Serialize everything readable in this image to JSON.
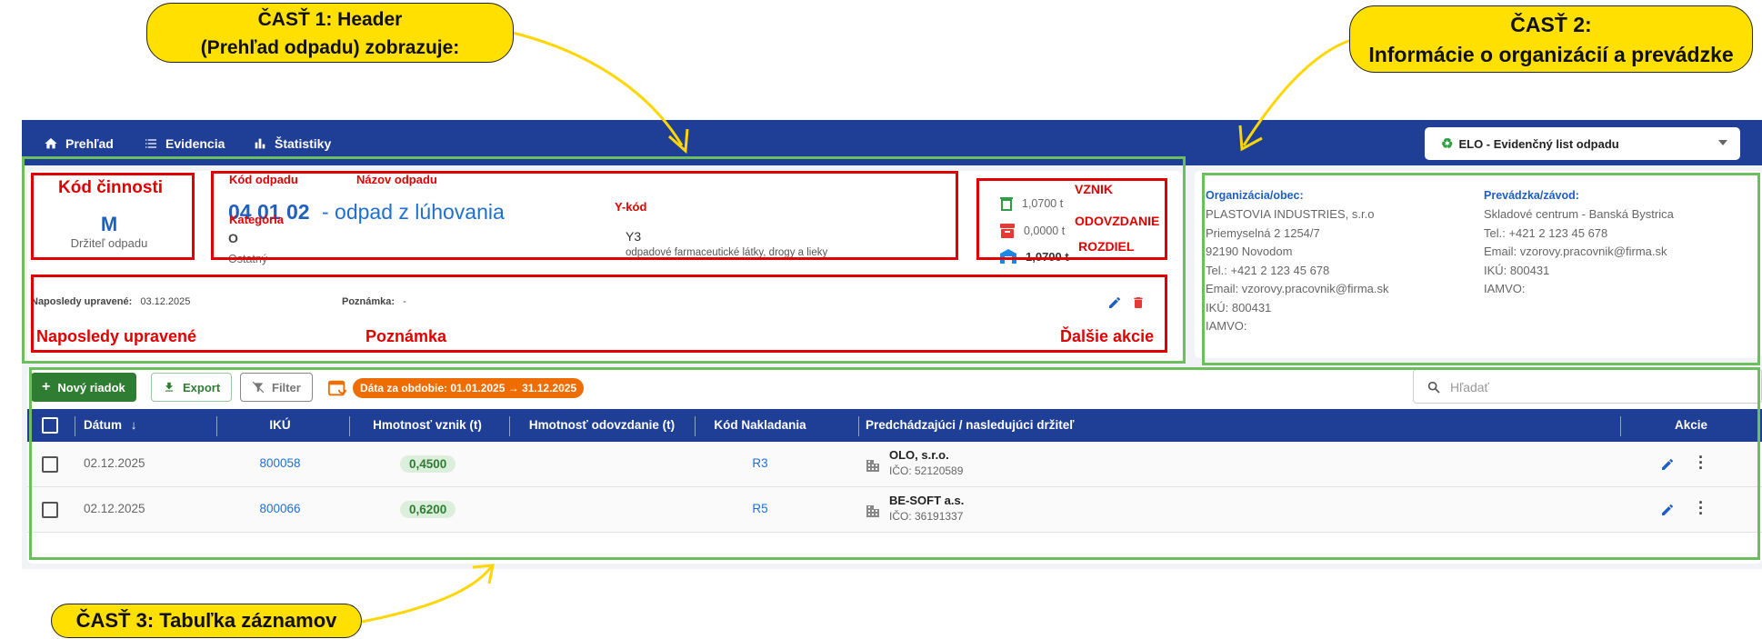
{
  "callouts": {
    "part1_line1": "ČASŤ 1: Header",
    "part1_line2": "(Prehľad odpadu) zobrazuje:",
    "part2_line1": "ČASŤ 2:",
    "part2_line2": "Informácie o organizácií a prevádzke",
    "part3": "ČASŤ 3: Tabuľka záznamov"
  },
  "nav": {
    "items": [
      {
        "label": "Prehľad",
        "icon": "home-icon"
      },
      {
        "label": "Evidencia",
        "icon": "list-icon"
      },
      {
        "label": "Štatistiky",
        "icon": "bar-chart-icon"
      }
    ],
    "select_value": "ELO - Evidenčný list odpadu"
  },
  "header": {
    "activity_code_title": "Kód činnosti",
    "activity_code": "M",
    "holder_label": "Držiteľ odpadu",
    "waste_code": "04 01 02",
    "waste_name": "- odpad z lúhovania",
    "category_short": "O",
    "category": "Ostatný",
    "y_code": "Y3",
    "y_desc": "odpadové farmaceutické látky, drogy a lieky",
    "vznik": "1,0700 t",
    "odovzdanie": "0,0000 t",
    "rozdiel": "1,0700 t",
    "last_edited_label": "Naposledy upravené:",
    "last_edited": "03.12.2025",
    "note_label": "Poznámka:",
    "note": "-"
  },
  "annotations": {
    "kod_odpadu": "Kód odpadu",
    "nazov_odpadu": "Názov odpadu",
    "kategoria": "Kategória",
    "y_kod": "Y-kód",
    "vznik": "VZNIK",
    "odovzdanie": "ODOVZDANIE",
    "rozdiel": "ROZDIEL",
    "naposledy": "Naposledy upravené",
    "poznamka": "Poznámka",
    "dalsie_akcie": "Ďalšie akcie"
  },
  "org": {
    "org_title": "Organizácia/obec:",
    "org_lines": [
      "PLASTOVIA INDUSTRIES, s.r.o",
      "Priemyselná 2 1254/7",
      "92190 Novodom",
      "Tel.: +421 2 123 45 678",
      "Email: vzorovy.pracovnik@firma.sk",
      "IKÚ: 800431",
      "IAMVO:"
    ],
    "plant_title": "Prevádzka/závod:",
    "plant_lines": [
      "Skladové centrum - Banská Bystrica",
      "Tel.: +421 2 123 45 678",
      "Email: vzorovy.pracovnik@firma.sk",
      "IKÚ: 800431",
      "IAMVO:"
    ]
  },
  "toolbar": {
    "new_row": "Nový riadok",
    "export": "Export",
    "filter": "Filter",
    "period": "Dáta za obdobie: 01.01.2025 → 31.12.2025",
    "search_placeholder": "Hľadať"
  },
  "table": {
    "headers": [
      "Dátum",
      "IKÚ",
      "Hmotnosť vznik (t)",
      "Hmotnosť odovzdanie (t)",
      "Kód Nakladania",
      "Predchádzajúci / nasledujúci držiteľ",
      "Akcie"
    ],
    "rows": [
      {
        "date": "02.12.2025",
        "iku": "800058",
        "vznik": "0,4500",
        "odovzdanie": "",
        "kod": "R3",
        "holder": "OLO, s.r.o.",
        "ico": "IČO: 52120589"
      },
      {
        "date": "02.12.2025",
        "iku": "800066",
        "vznik": "0,6200",
        "odovzdanie": "",
        "kod": "R5",
        "holder": "BE-SOFT a.s.",
        "ico": "IČO: 36191337"
      }
    ]
  },
  "colors": {
    "nav": "#1f3f97",
    "annotation_red": "#e00000",
    "annotation_green": "#6cbf5c",
    "callout_yellow": "#ffe000",
    "primary_green": "#2e7d32",
    "period_orange": "#ef6c00"
  }
}
